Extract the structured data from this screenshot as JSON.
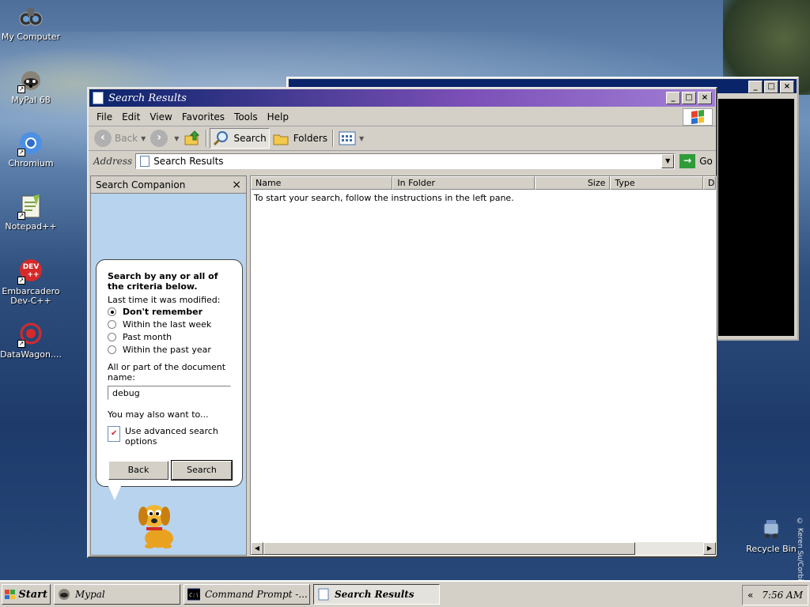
{
  "desktop": {
    "icons": [
      {
        "label": "My Computer"
      },
      {
        "label": "MyPal 68"
      },
      {
        "label": "Chromium"
      },
      {
        "label": "Notepad++"
      },
      {
        "label": "Embarcadero Dev-C++"
      },
      {
        "label": "DataWagon...."
      },
      {
        "label": "Recycle Bin"
      }
    ],
    "watermark": "© Keren Su/Corbis"
  },
  "window": {
    "title": "Search Results",
    "menu": [
      "File",
      "Edit",
      "View",
      "Favorites",
      "Tools",
      "Help"
    ],
    "toolbar": {
      "back_label": "Back",
      "search_label": "Search",
      "folders_label": "Folders"
    },
    "address": {
      "label": "Address",
      "value": "Search Results",
      "go_label": "Go"
    }
  },
  "companion": {
    "header": "Search Companion",
    "close_glyph": "×",
    "heading": "Search by any or all of the criteria below.",
    "modified_label": "Last time it was modified:",
    "options": [
      {
        "label": "Don't remember",
        "selected": true
      },
      {
        "label": "Within the last week",
        "selected": false
      },
      {
        "label": "Past month",
        "selected": false
      },
      {
        "label": "Within the past year",
        "selected": false
      }
    ],
    "name_label": "All or part of the document name:",
    "name_value": "debug",
    "also_label": "You may also want to...",
    "advanced_label": "Use advanced search options",
    "back_button": "Back",
    "search_button": "Search"
  },
  "results": {
    "columns": [
      "Name",
      "In Folder",
      "Size",
      "Type",
      "D"
    ],
    "message": "To start your search, follow the instructions in the left pane."
  },
  "taskbar": {
    "start_label": "Start",
    "tasks": [
      {
        "label": "Mypal",
        "active": false
      },
      {
        "label": "Command Prompt -...",
        "active": false
      },
      {
        "label": "Search Results",
        "active": true
      }
    ],
    "tray_chevron": "«",
    "clock": "7:56 AM"
  }
}
